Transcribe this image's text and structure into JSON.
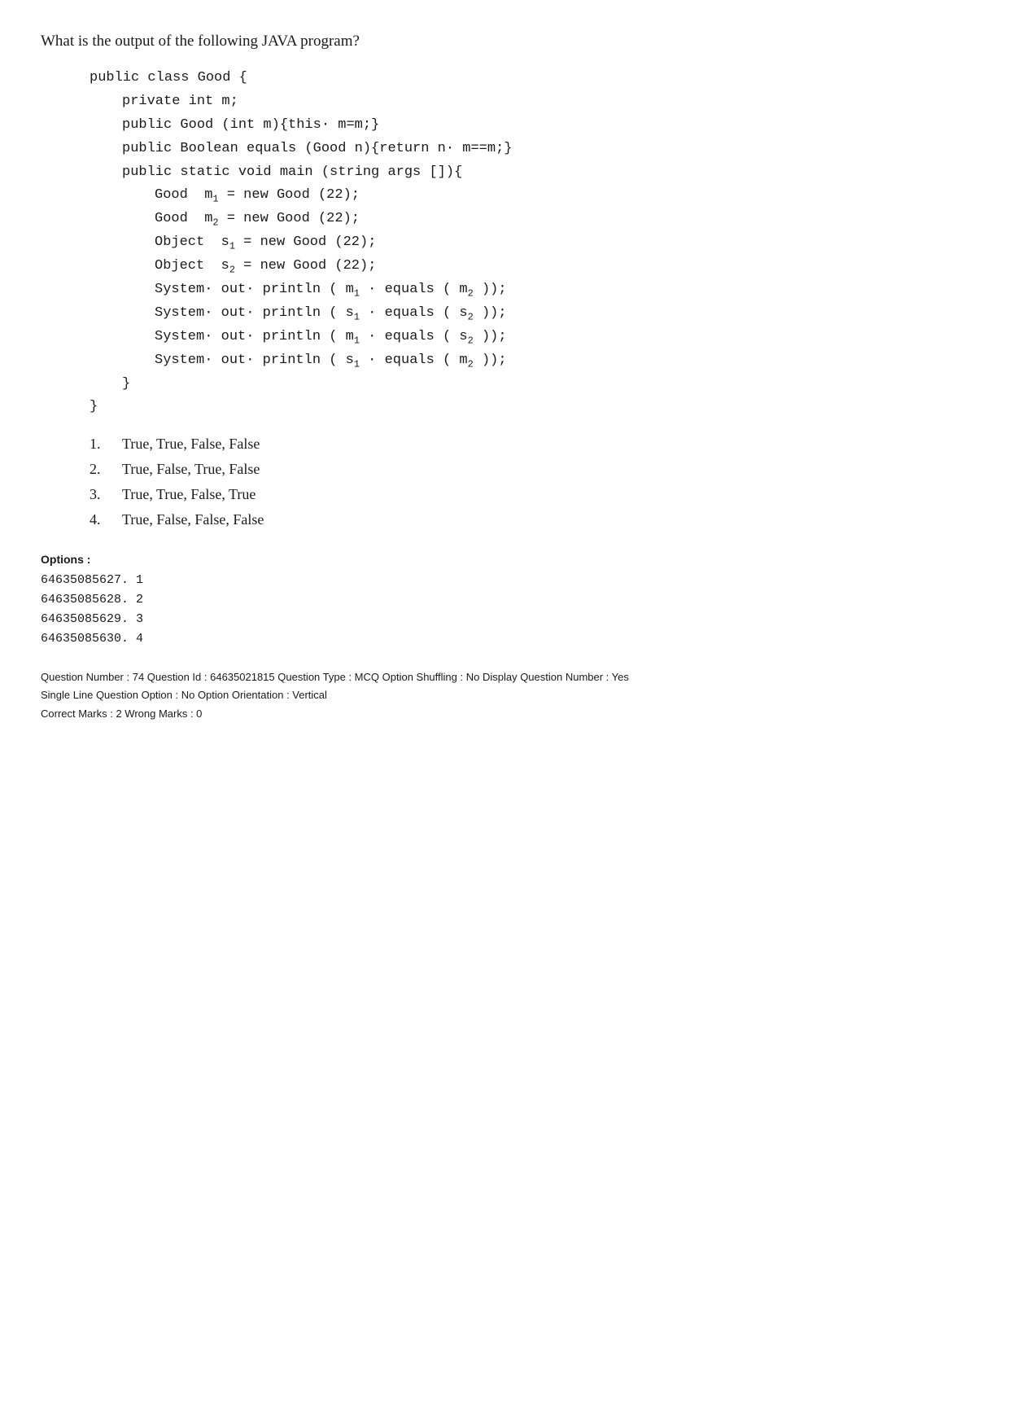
{
  "question": {
    "text": "What is the output of the following JAVA program?",
    "code_lines": [
      {
        "indent": 0,
        "text": "public class Good {"
      },
      {
        "indent": 1,
        "text": "private int m;"
      },
      {
        "indent": 1,
        "text": "public Good (int m){this· m=m;}"
      },
      {
        "indent": 1,
        "text": "public Boolean equals (Good n){return n· m==m;}"
      },
      {
        "indent": 1,
        "text": "public static void main (string args []){"
      },
      {
        "indent": 2,
        "text": "Good  m₁ = new Good (22);"
      },
      {
        "indent": 2,
        "text": "Good  m₂ = new Good (22);"
      },
      {
        "indent": 2,
        "text": "Object  s₁ = new Good (22);"
      },
      {
        "indent": 2,
        "text": "Object  s₂ = new Good (22);"
      },
      {
        "indent": 2,
        "text": "System· out· println ( m₁ · equals ( m₂ ));"
      },
      {
        "indent": 2,
        "text": "System· out· println ( s₁ · equals ( s₂ ));"
      },
      {
        "indent": 2,
        "text": "System· out· println ( m₁ · equals ( s₂ ));"
      },
      {
        "indent": 2,
        "text": "System· out· println ( s₁ · equals ( m₂ ));"
      },
      {
        "indent": 1,
        "text": "}"
      },
      {
        "indent": 0,
        "text": "}"
      }
    ],
    "options": [
      {
        "number": "1.",
        "text": "True, True, False, False"
      },
      {
        "number": "2.",
        "text": "True, False, True, False"
      },
      {
        "number": "3.",
        "text": "True, True, False, True"
      },
      {
        "number": "4.",
        "text": "True, False, False, False"
      }
    ]
  },
  "options_section": {
    "label": "Options :",
    "items": [
      "64635085627. 1",
      "64635085628. 2",
      "64635085629. 3",
      "64635085630. 4"
    ]
  },
  "meta": {
    "line1": "Question Number : 74  Question Id : 64635021815  Question Type : MCQ  Option Shuffling : No  Display Question Number : Yes",
    "line2": "Single Line Question Option : No  Option Orientation : Vertical",
    "line3": "Correct Marks : 2  Wrong Marks : 0"
  }
}
